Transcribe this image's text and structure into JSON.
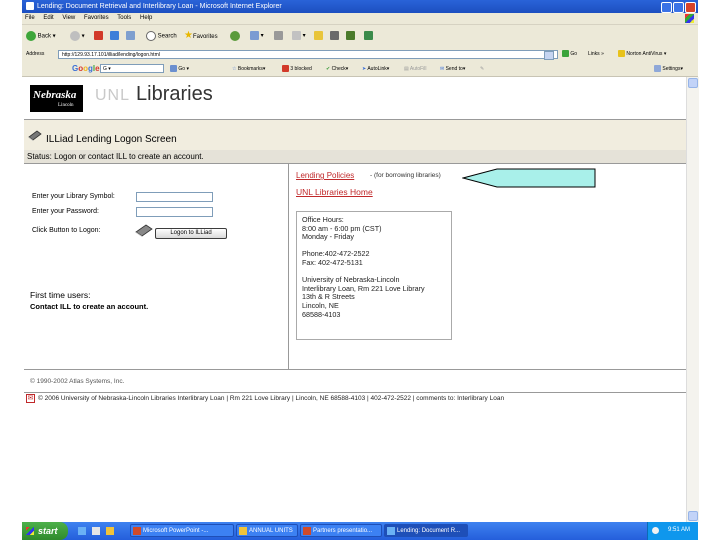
{
  "window": {
    "title": "Lending: Document Retrieval and Interlibrary Loan - Microsoft Internet Explorer"
  },
  "menu": [
    "File",
    "Edit",
    "View",
    "Favorites",
    "Tools",
    "Help"
  ],
  "toolbar": {
    "back": "Back",
    "search": "Search",
    "favorites": "Favorites"
  },
  "address": {
    "label": "Address",
    "url": "http://129.93.17.101/illiad/lending/logon.html",
    "go": "Go",
    "links": "Links",
    "norton": "Norton AntiVirus"
  },
  "googlebar": {
    "logo": [
      "G",
      "o",
      "o",
      "g",
      "l",
      "e"
    ],
    "logo_colors": [
      "#3b6fd6",
      "#d6352b",
      "#f0b31f",
      "#3b6fd6",
      "#3ea43a",
      "#d6352b"
    ],
    "search_value": "G",
    "go": "Go",
    "bookmarks": "Bookmarks",
    "blocked": "3 blocked",
    "check": "Check",
    "autolink": "AutoLink",
    "autofill": "AutoFill",
    "sendto": "Send to",
    "settings": "Settings"
  },
  "header": {
    "nebraska": "Nebraska",
    "lincoln": "Lincoln",
    "unl": "UNL",
    "libraries": "Libraries"
  },
  "page": {
    "title": "ILLiad Lending Logon Screen",
    "status": "Status: Logon or contact ILL to create an account.",
    "symbol_label": "Enter your Library Symbol:",
    "password_label": "Enter your Password:",
    "click_label": "Click Button to Logon:",
    "logon_button": "Logon to ILLiad",
    "first_time": "First time users:",
    "contact": "Contact ILL to create an account.",
    "lending_policies": "Lending Policies",
    "lending_policies_note": "- (for borrowing libraries)",
    "unl_home": "UNL Libraries Home",
    "office_hours": [
      "Office Hours:",
      "8:00 am - 6:00 pm (CST)",
      "Monday - Friday",
      "",
      "Phone:402-472-2522",
      "Fax: 402-472-5131",
      "",
      "University of Nebraska-Lincoln",
      "Interlibrary Loan, Rm 221 Love Library",
      "13th & R Streets",
      "Lincoln, NE",
      "68588-4103"
    ],
    "copyright": "© 1990-2002 Atlas Systems, Inc.",
    "footer": "© 2006 University of Nebraska-Lincoln Libraries Interlibrary Loan | Rm 221 Love Library | Lincoln, NE 68588-4103 | 402-472-2522 | comments to: Interlibrary Loan"
  },
  "taskbar": {
    "start": "start",
    "tasks": [
      "Microsoft PowerPoint -...",
      "ANNUAL UNITS",
      "Partners presentatio...",
      "Lending: Document R..."
    ],
    "clock": "9:51 AM"
  }
}
